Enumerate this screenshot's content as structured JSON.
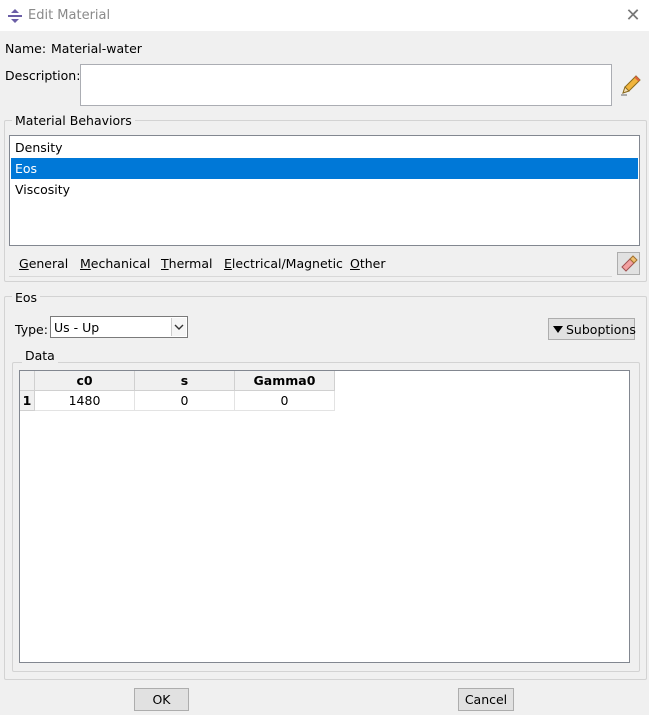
{
  "window": {
    "title": "Edit Material",
    "close_glyph": "✕"
  },
  "name": {
    "label": "Name:",
    "value": "Material-water"
  },
  "description": {
    "label": "Description:",
    "value": "",
    "edit_icon": "pencil-icon"
  },
  "behaviors": {
    "group_title": "Material Behaviors",
    "items": [
      {
        "label": "Density",
        "selected": false
      },
      {
        "label": "Eos",
        "selected": true
      },
      {
        "label": "Viscosity",
        "selected": false
      }
    ],
    "menus": [
      "General",
      "Mechanical",
      "Thermal",
      "Electrical/Magnetic",
      "Other"
    ],
    "delete_icon": "eraser-icon"
  },
  "eos": {
    "group_title": "Eos",
    "type_label": "Type:",
    "type_value": "Us - Up",
    "suboptions_label": "Suboptions",
    "data_group_title": "Data",
    "table": {
      "columns": [
        "c0",
        "s",
        "Gamma0"
      ],
      "rows": [
        {
          "index": "1",
          "cells": [
            "1480",
            "0",
            "0"
          ]
        }
      ]
    }
  },
  "buttons": {
    "ok": "OK",
    "cancel": "Cancel"
  },
  "colors": {
    "selection": "#0078d7"
  }
}
